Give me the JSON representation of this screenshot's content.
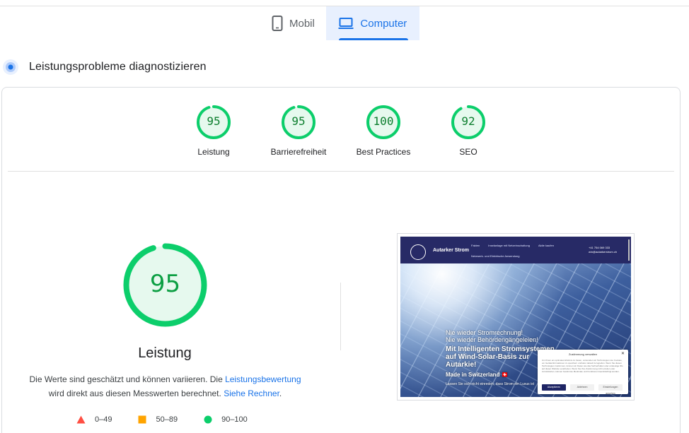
{
  "tabs": [
    {
      "label": "Mobil",
      "icon": "smartphone-icon",
      "active": false
    },
    {
      "label": "Computer",
      "icon": "laptop-icon",
      "active": true
    }
  ],
  "section": {
    "title": "Leistungsprobleme diagnostizieren",
    "icon": "diagnostic-icon"
  },
  "categories": [
    {
      "score": "95",
      "label": "Leistung",
      "value": 95
    },
    {
      "score": "95",
      "label": "Barrierefreiheit",
      "value": 95
    },
    {
      "score": "100",
      "label": "Best Practices",
      "value": 100
    },
    {
      "score": "92",
      "label": "SEO",
      "value": 92
    }
  ],
  "performance": {
    "score": "95",
    "value": 95,
    "title": "Leistung",
    "desc_part1": "Die Werte sind geschätzt und können variieren. Die ",
    "desc_link1": "Leistungsbewertung",
    "desc_part2": " wird direkt aus diesen Messwerten berechnet. ",
    "desc_link2": "Siehe Rechner",
    "desc_part3": "."
  },
  "legend": [
    {
      "range": "0–49",
      "shape": "triangle",
      "color": "#ff4e42"
    },
    {
      "range": "50–89",
      "shape": "square",
      "color": "#ffa400"
    },
    {
      "range": "90–100",
      "shape": "circle",
      "color": "#0cce6b"
    }
  ],
  "colors": {
    "pass": "#0cce6b",
    "pass_text": "#0c7e2e",
    "pass_bg": "#e6f9ee",
    "accent": "#1a73e8"
  },
  "screenshot": {
    "brand": "Autarker Strom",
    "nav_links": [
      "Fakten",
      "Inselanlage mit Netzeinschaltung",
      "Aktie kaufen"
    ],
    "nav_sub": "Netzwerk- und Elektrische Anwendung",
    "phone": "+41 754 069 333",
    "email": "win@autarkerstrom.ch",
    "line1": "Nie wieder Stromrechnung!",
    "line2": "Nie wieder Behördengängeleien!",
    "headline1": "Mit Intelligenten Stromsystemen",
    "headline2": "auf Wind-Solar-Basis zur",
    "headline3": "Autarkie!",
    "made_in": "Made in Switzerland 🇨🇭",
    "small": "Lassen Sie sich nicht einreden, dass Strom ein Luxus ist",
    "cookie": {
      "title": "Zustimmung verwalten",
      "body": "Um Ihnen ein optimales Erlebnis zu bieten, verwenden wir Technologien wie Cookies, um Geräteinformationen zu speichern und/oder darauf zuzugreifen. Wenn Sie diesen Technologien zustimmen, können wir Daten wie das Surfverhalten oder eindeutige IDs auf dieser Website verarbeiten. Wenn Sie Ihre Zustimmung nicht erteilen oder zurückziehen, können bestimmte Merkmale und Funktionen beeinträchtigt werden.",
      "accept": "Akzeptieren",
      "reject": "Ablehnen",
      "settings": "Einstellungen ansehen"
    }
  }
}
